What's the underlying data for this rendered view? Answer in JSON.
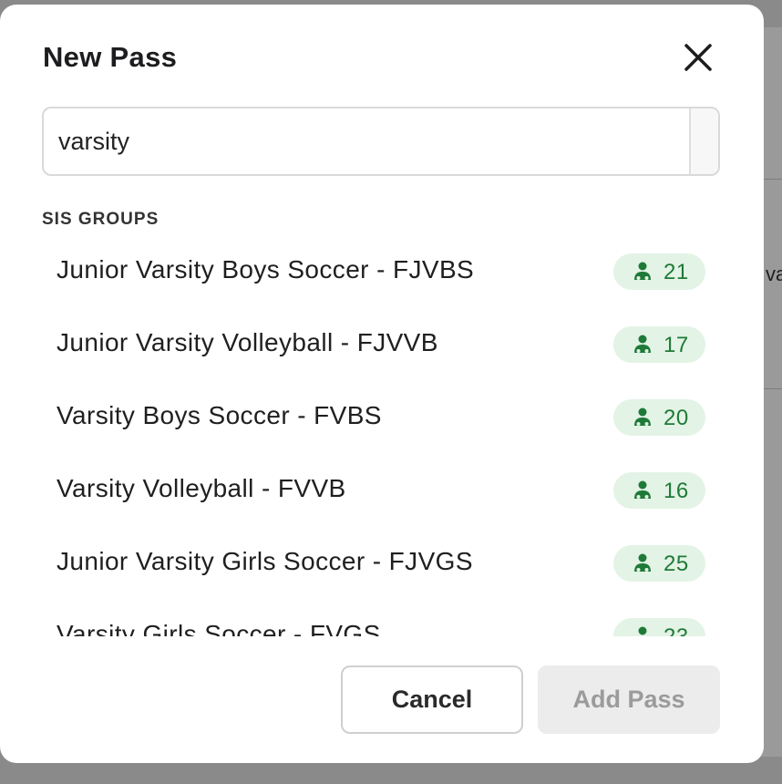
{
  "modal": {
    "title": "New Pass",
    "close_icon": "close-icon"
  },
  "search": {
    "value": "varsity",
    "placeholder": ""
  },
  "section": {
    "label": "SIS GROUPS"
  },
  "groups": [
    {
      "label": "Junior Varsity Boys Soccer - FJVBS",
      "count": "21",
      "icon": "person-icon"
    },
    {
      "label": "Junior Varsity Volleyball - FJVVB",
      "count": "17",
      "icon": "person-icon"
    },
    {
      "label": "Varsity Boys Soccer - FVBS",
      "count": "20",
      "icon": "person-icon"
    },
    {
      "label": "Varsity Volleyball - FVVB",
      "count": "16",
      "icon": "person-icon"
    },
    {
      "label": "Junior Varsity Girls Soccer - FJVGS",
      "count": "25",
      "icon": "person-icon"
    },
    {
      "label": "Varsity Girls Soccer - FVGS",
      "count": "23",
      "icon": "person-icon"
    }
  ],
  "footer": {
    "cancel_label": "Cancel",
    "add_label": "Add Pass"
  },
  "background": {
    "partial_text": "va"
  },
  "colors": {
    "badge_bg": "#e3f3e5",
    "badge_fg": "#1f7a38",
    "disabled_button_bg": "#ececec",
    "disabled_button_fg": "#9b9b9b"
  }
}
